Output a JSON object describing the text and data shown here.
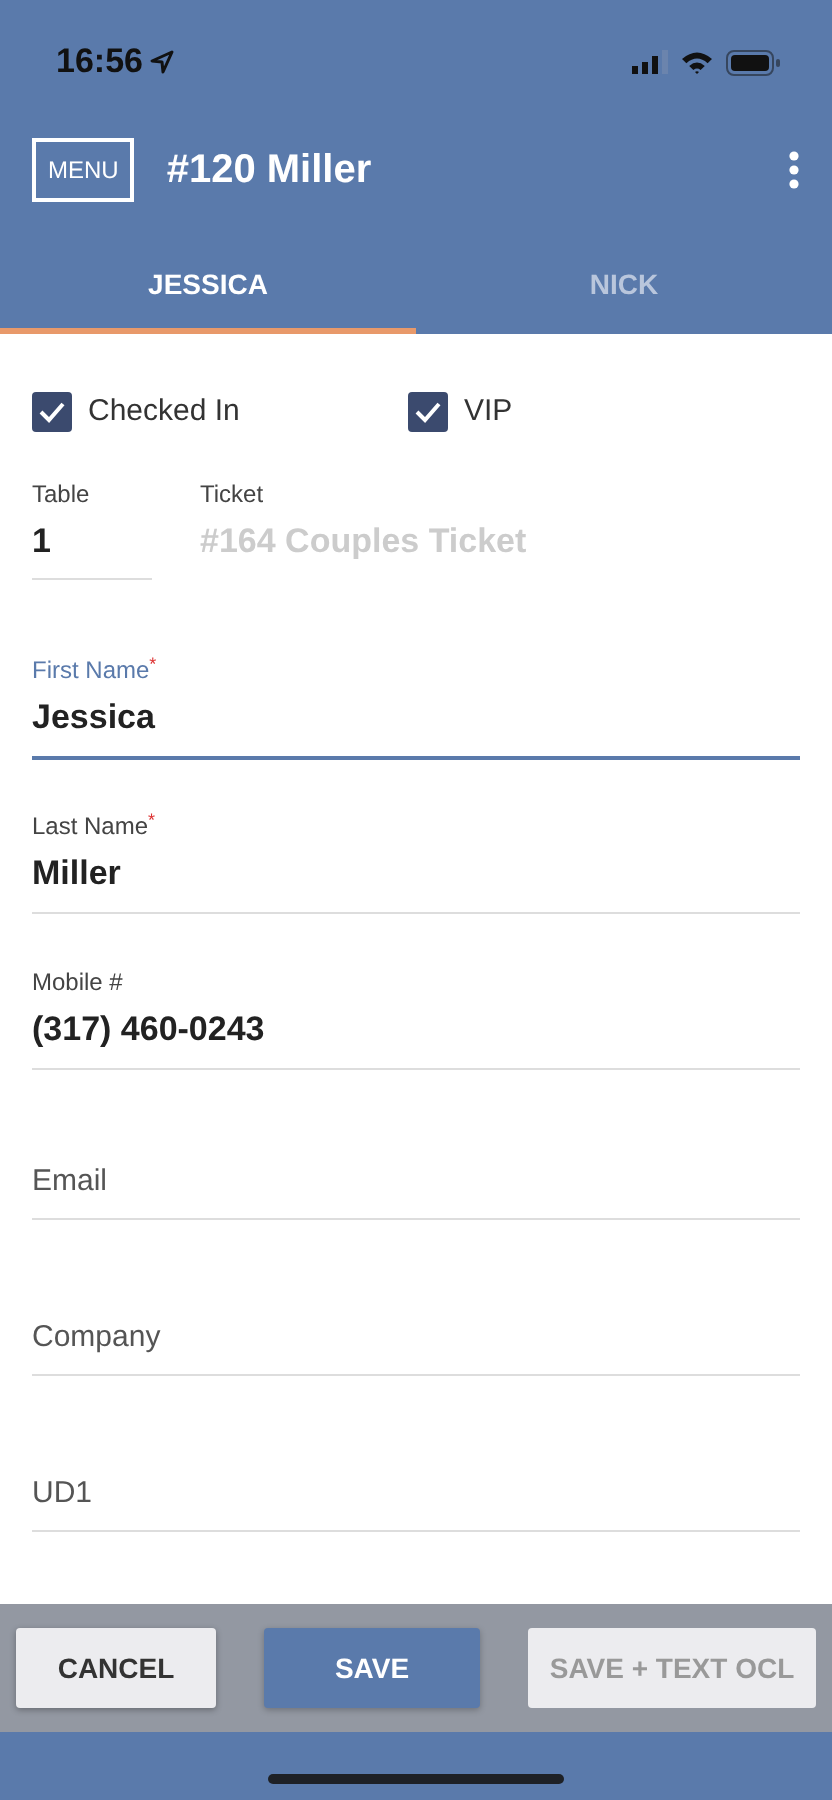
{
  "status_bar": {
    "time": "16:56"
  },
  "header": {
    "menu_button": "MENU",
    "title": "#120 Miller"
  },
  "tabs": [
    {
      "label": "JESSICA",
      "selected": true
    },
    {
      "label": "NICK",
      "selected": false
    }
  ],
  "checkboxes": [
    {
      "label": "Checked In",
      "checked": true
    },
    {
      "label": "VIP",
      "checked": true
    }
  ],
  "inline_fields": [
    {
      "label": "Table",
      "value": "1",
      "disabled": false
    },
    {
      "label": "Ticket",
      "value": "#164 Couples Ticket",
      "disabled": true
    }
  ],
  "fields": [
    {
      "label": "First Name$^{*}$",
      "value": "Jessica",
      "focused": true
    },
    {
      "label": "Last Name$^{*}$",
      "value": "Miller",
      "focused": false
    },
    {
      "label": "Mobile #",
      "value": "(317) 460-0243",
      "focused": false
    },
    {
      "placeholder": "Email",
      "focused": false
    },
    {
      "placeholder": "Company",
      "focused": false
    },
    {
      "placeholder": "UD1",
      "focused": false
    }
  ],
  "buttons": [
    {
      "label": "CANCEL",
      "kind": "secondary",
      "disabled": false
    },
    {
      "label": "SAVE",
      "kind": "primary",
      "disabled": false
    },
    {
      "label": "SAVE + TEXT OCL",
      "kind": "secondary",
      "disabled": true
    }
  ]
}
